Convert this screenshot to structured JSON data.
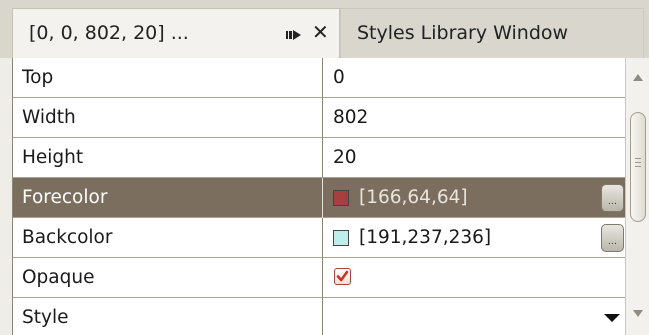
{
  "tabs": {
    "active": {
      "title": "[0, 0, 802, 20] ..."
    },
    "inactive": {
      "title": "Styles Library Window"
    }
  },
  "properties": [
    {
      "name": "Top",
      "value": "0"
    },
    {
      "name": "Width",
      "value": "802"
    },
    {
      "name": "Height",
      "value": "20"
    },
    {
      "name": "Forecolor",
      "value": "[166,64,64]",
      "swatch": "#a64040",
      "selected": true
    },
    {
      "name": "Backcolor",
      "value": "[191,237,236]",
      "swatch": "#bfedec"
    },
    {
      "name": "Opaque",
      "checked": true
    },
    {
      "name": "Style",
      "value": ""
    }
  ],
  "colors": {
    "selected_row": "#7b6e5f",
    "checkbox_mark": "#cc3322"
  },
  "icons": {
    "pin": "pin-panel-icon",
    "close": "close-icon",
    "ellipsis": "ellipsis-button-icon",
    "dropdown": "dropdown-arrow-icon",
    "checkmark": "checkmark-icon"
  }
}
